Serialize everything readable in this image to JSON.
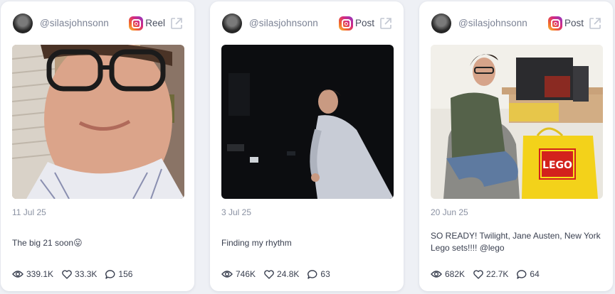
{
  "cards": [
    {
      "username": "@silasjohnsonn",
      "type": "Reel",
      "date": "11 Jul 25",
      "caption": "The big 21 soon😛",
      "views": "339.1K",
      "likes": "33.3K",
      "comments": "156"
    },
    {
      "username": "@silasjohnsonn",
      "type": "Post",
      "date": "3 Jul 25",
      "caption": "Finding my rhythm",
      "views": "746K",
      "likes": "24.8K",
      "comments": "63"
    },
    {
      "username": "@silasjohnsonn",
      "type": "Post",
      "date": "20 Jun 25",
      "caption": "SO READY! Twilight, Jane Austen, New York Lego sets!!!! @lego",
      "views": "682K",
      "likes": "22.7K",
      "comments": "64"
    }
  ],
  "icons": {
    "platform": "instagram-icon",
    "open": "external-link-icon",
    "views": "eye-icon",
    "likes": "heart-icon",
    "comments": "comment-icon"
  },
  "photo_text": {
    "brand": "LEGO"
  }
}
